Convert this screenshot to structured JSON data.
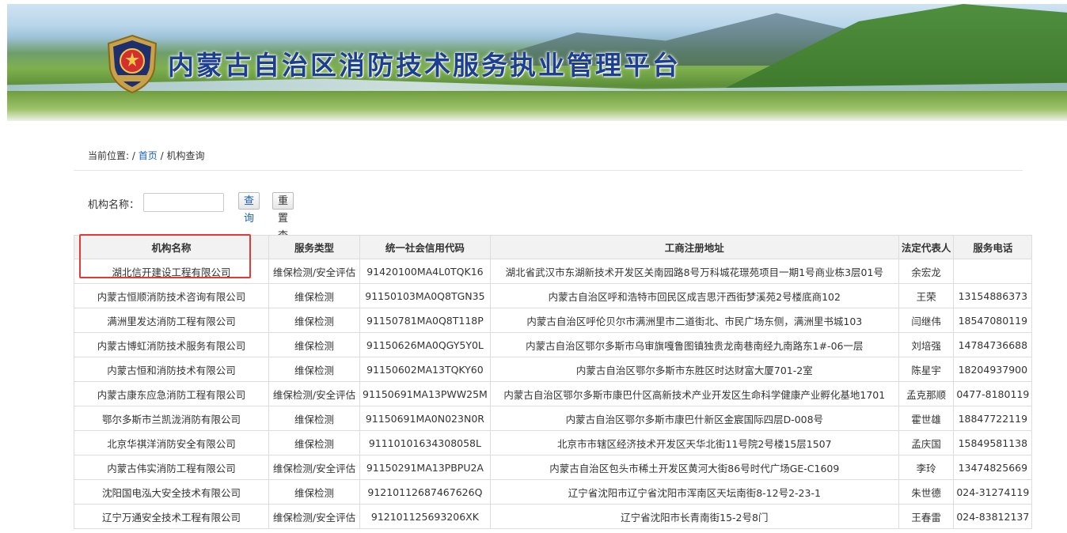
{
  "banner": {
    "title": "内蒙古自治区消防技术服务执业管理平台"
  },
  "breadcrumb": {
    "prefix": "当前位置: /",
    "home": "首页",
    "sep": "/",
    "current": "机构查询"
  },
  "search": {
    "label": "机构名称：",
    "value": "",
    "placeholder": "",
    "query_button": "查询",
    "reset_button": "重置查询"
  },
  "table": {
    "headers": [
      "机构名称",
      "服务类型",
      "统一社会信用代码",
      "工商注册地址",
      "法定代表人",
      "服务电话"
    ],
    "rows": [
      [
        "湖北信开建设工程有限公司",
        "维保检测/安全评估",
        "91420100MA4L0TQK16",
        "湖北省武汉市东湖新技术开发区关南园路8号万科城花璟苑项目一期1号商业栋3层01号",
        "余宏龙",
        ""
      ],
      [
        "内蒙古恒顺消防技术咨询有限公司",
        "维保检测",
        "91150103MA0Q8TGN35",
        "内蒙古自治区呼和浩特市回民区成吉思汗西街梦溪苑2号楼底商102",
        "王荣",
        "13154886373"
      ],
      [
        "满洲里发达消防工程有限公司",
        "维保检测",
        "91150781MA0Q8T118P",
        "内蒙古自治区呼伦贝尔市满洲里市二道街北、市民广场东侧，满洲里书城103",
        "闫继伟",
        "18547080119"
      ],
      [
        "内蒙古博虹消防技术服务有限公司",
        "维保检测",
        "91150626MA0QGY5Y0L",
        "内蒙古自治区鄂尔多斯市乌审旗嘎鲁图镇独贵龙南巷南经九南路东1#-06一层",
        "刘培强",
        "14784736688"
      ],
      [
        "内蒙古恒和消防技术有限公司",
        "维保检测",
        "91150602MA13TQKY60",
        "内蒙古自治区鄂尔多斯市东胜区时达财富大厦701-2室",
        "陈星宇",
        "18204937900"
      ],
      [
        "内蒙古康东应急消防工程有限公司",
        "维保检测/安全评估",
        "91150691MA13PWW25M",
        "内蒙古自治区鄂尔多斯市康巴什区高新技术产业开发区生命科学健康产业孵化基地1701",
        "孟克那顺",
        "0477-8180119"
      ],
      [
        "鄂尔多斯市兰凯泷消防有限公司",
        "维保检测",
        "91150691MA0N023N0R",
        "内蒙古自治区鄂尔多斯市康巴什新区金宸国际四层D-008号",
        "霍世雄",
        "18847722119"
      ],
      [
        "北京华祺洋消防安全有限公司",
        "维保检测",
        "91110101634308058L",
        "北京市市辖区经济技术开发区天华北街11号院2号楼15层1507",
        "孟庆国",
        "15849581138"
      ],
      [
        "内蒙古伟实消防工程有限公司",
        "维保检测/安全评估",
        "91150291MA13PBPU2A",
        "内蒙古自治区包头市稀土开发区黄河大街86号时代广场GE-C1609",
        "李玲",
        "13474825669"
      ],
      [
        "沈阳国电泓大安全技术有限公司",
        "维保检测",
        "91210112687467626Q",
        "辽宁省沈阳市辽宁省沈阳市浑南区天坛南街8-12号2-23-1",
        "朱世德",
        "024-31274119"
      ],
      [
        "辽宁万通安全技术工程有限公司",
        "维保检测/安全评估",
        "912101125693206XK",
        "辽宁省沈阳市长青南街15-2号8门",
        "王春雷",
        "024-83812137"
      ]
    ]
  },
  "colors": {
    "title": "#1c3f8f",
    "link": "#1a5fb4",
    "highlight": "#e53935",
    "header_bg": "#f2f2f2"
  },
  "icons": {
    "emblem": "fire-rescue-emblem-icon"
  }
}
